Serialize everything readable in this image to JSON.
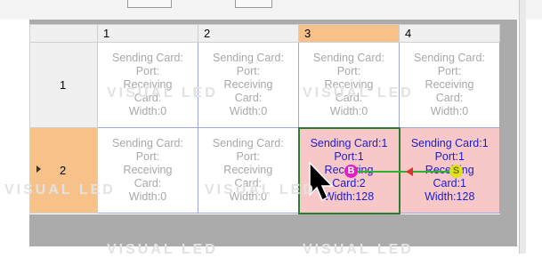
{
  "grid": {
    "columns": [
      "1",
      "2",
      "3",
      "4"
    ],
    "selected_column": "3",
    "rows": [
      {
        "label": "1",
        "cells": [
          {
            "lines": [
              "Sending Card:",
              "Port:",
              "Receiving",
              "Card:",
              "Width:0"
            ]
          },
          {
            "lines": [
              "Sending Card:",
              "Port:",
              "Receiving",
              "Card:",
              "Width:0"
            ]
          },
          {
            "lines": [
              "Sending Card:",
              "Port:",
              "Receiving",
              "Card:",
              "Width:0"
            ]
          },
          {
            "lines": [
              "Sending Card:",
              "Port:",
              "Receiving",
              "Card:",
              "Width:0"
            ]
          }
        ]
      },
      {
        "label": "2",
        "cells": [
          {
            "lines": [
              "Sending Card:",
              "Port:",
              "Receiving",
              "Card:",
              "Width:0"
            ]
          },
          {
            "lines": [
              "Sending Card:",
              "Port:",
              "Receiving",
              "Card:",
              "Width:0"
            ]
          },
          {
            "lines": [
              "Sending Card:1",
              "Port:1",
              "Receiving",
              "Card:2",
              "Width:128"
            ]
          },
          {
            "lines": [
              "Sending Card:1",
              "Port:1",
              "Receiving",
              "Card:1",
              "Width:128"
            ]
          }
        ]
      }
    ]
  },
  "markers": {
    "begin": "B",
    "start": "S"
  },
  "colors": {
    "selected_header": "#f7c28a",
    "active_text": "#1c1cc8",
    "inactive_text": "#a8a8a8",
    "linked_cell": "#f8c8c8",
    "current_border": "#2e7d2e"
  },
  "watermark": "VISUAL LED"
}
